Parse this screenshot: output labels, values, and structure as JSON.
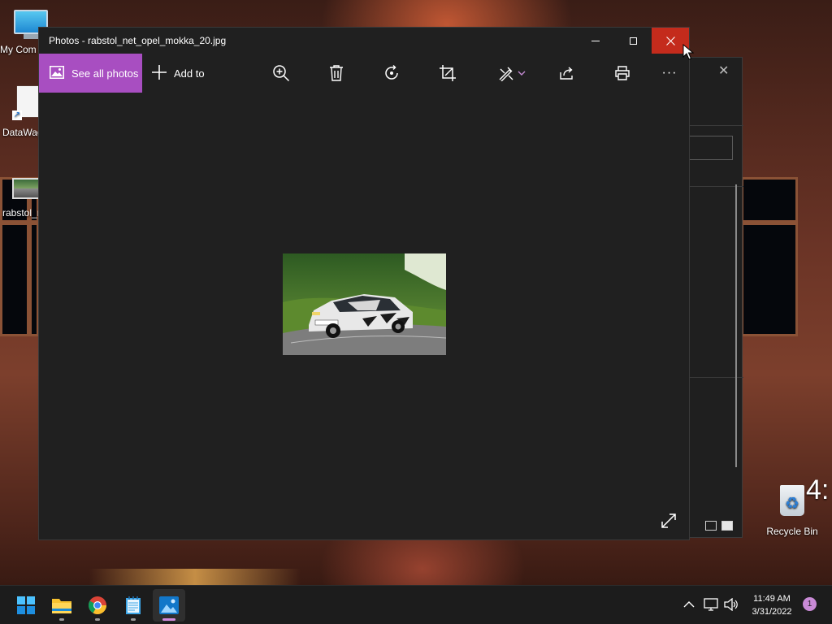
{
  "desktop": {
    "icons": [
      {
        "label": "My Com"
      },
      {
        "label": "DataWag"
      },
      {
        "label": "rabstol_n"
      },
      {
        "label": "Recycle Bin"
      }
    ],
    "partial_clock_text": "4:"
  },
  "photos_window": {
    "title": "Photos - rabstol_net_opel_mokka_20.jpg",
    "accent_color": "#a84ec1",
    "close_hover_color": "#c42b1c",
    "toolbar": {
      "see_all_label": "See all photos",
      "add_to_label": "Add to",
      "icons": [
        "zoom-in-icon",
        "delete-icon",
        "rotate-icon",
        "crop-icon",
        "edit-icon",
        "share-icon",
        "print-icon",
        "more-icon"
      ],
      "more_label": "···"
    }
  },
  "taskbar": {
    "apps": [
      "start",
      "file-explorer",
      "chrome",
      "notepad",
      "photos"
    ],
    "active_app": "photos",
    "clock": {
      "time": "11:49 AM",
      "date": "3/31/2022"
    },
    "notification_count": "1"
  }
}
